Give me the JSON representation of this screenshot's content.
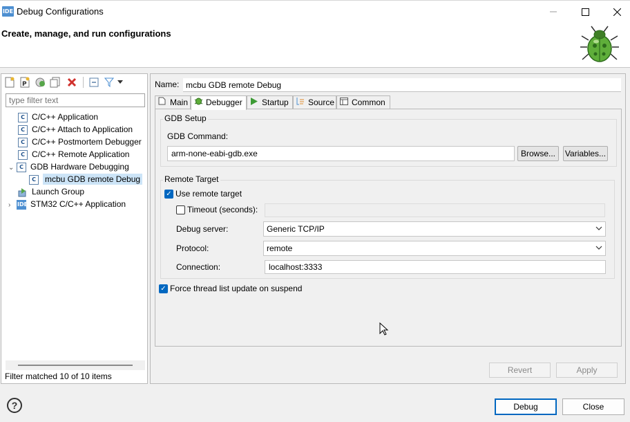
{
  "window": {
    "title": "Debug Configurations",
    "icon_text": "IDE"
  },
  "banner": {
    "title": "Create, manage, and run configurations"
  },
  "left": {
    "filter_placeholder": "type filter text",
    "tree": [
      {
        "label": "C/C++ Application",
        "icon": "C"
      },
      {
        "label": "C/C++ Attach to Application",
        "icon": "C"
      },
      {
        "label": "C/C++ Postmortem Debugger",
        "icon": "C"
      },
      {
        "label": "C/C++ Remote Application",
        "icon": "C"
      },
      {
        "label": "GDB Hardware Debugging",
        "icon": "C"
      },
      {
        "label": "mcbu GDB remote Debug",
        "icon": "C"
      },
      {
        "label": "Launch Group",
        "icon": ""
      },
      {
        "label": "STM32 C/C++ Application",
        "icon": "IDE"
      }
    ],
    "status": "Filter matched 10 of 10 items"
  },
  "right": {
    "name_label": "Name:",
    "name_value": "mcbu GDB remote Debug",
    "tabs": [
      "Main",
      "Debugger",
      "Startup",
      "Source",
      "Common"
    ],
    "gdb_setup": {
      "group_label": "GDB Setup",
      "command_label": "GDB Command:",
      "command_value": "arm-none-eabi-gdb.exe",
      "browse_label": "Browse...",
      "variables_label": "Variables..."
    },
    "remote_target": {
      "group_label": "Remote Target",
      "use_remote_label": "Use remote target",
      "use_remote_checked": true,
      "timeout_label": "Timeout (seconds):",
      "timeout_checked": false,
      "timeout_value": "",
      "debug_server_label": "Debug server:",
      "debug_server_value": "Generic TCP/IP",
      "protocol_label": "Protocol:",
      "protocol_value": "remote",
      "connection_label": "Connection:",
      "connection_value": "localhost:3333"
    },
    "force_thread_label": "Force thread list update on suspend",
    "force_thread_checked": true,
    "revert_label": "Revert",
    "apply_label": "Apply"
  },
  "footer": {
    "debug_label": "Debug",
    "close_label": "Close"
  },
  "colors": {
    "accent": "#0067c0",
    "selection": "#cce4f7"
  }
}
